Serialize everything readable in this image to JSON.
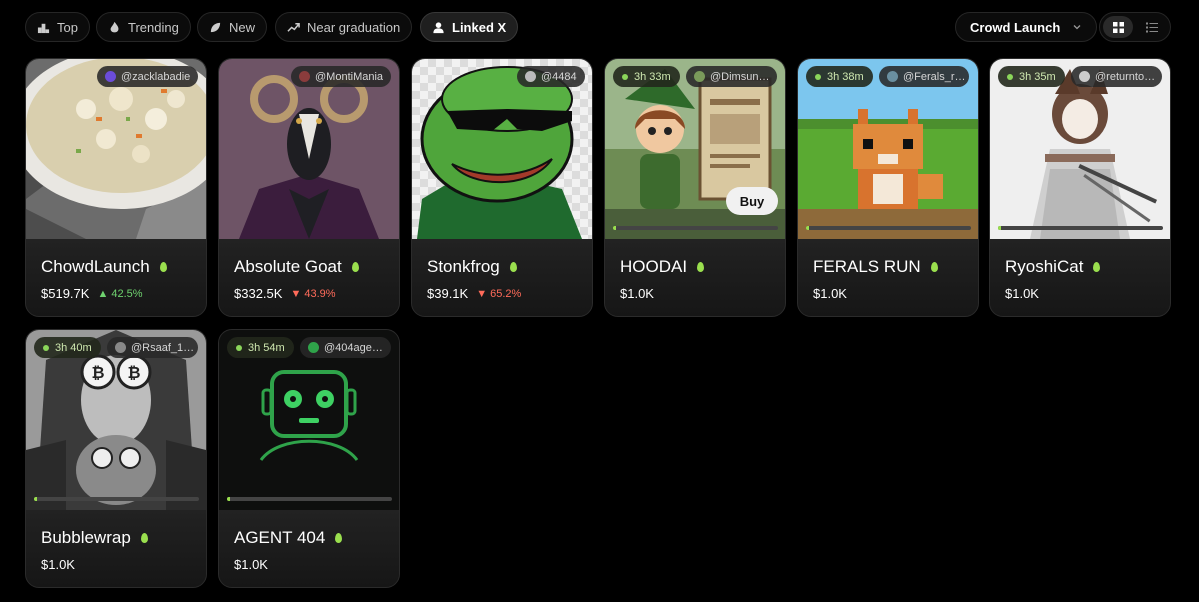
{
  "tabs": [
    {
      "label": "Top",
      "icon": "podium-icon"
    },
    {
      "label": "Trending",
      "icon": "flame-icon"
    },
    {
      "label": "New",
      "icon": "leaf-icon"
    },
    {
      "label": "Near graduation",
      "icon": "trend-up-icon"
    },
    {
      "label": "Linked X",
      "icon": "user-icon",
      "active": true
    }
  ],
  "launch_filter": {
    "label": "Crowd Launch"
  },
  "view": {
    "active": "grid"
  },
  "colors": {
    "accent": "#9adf4e",
    "up": "#6fd26f",
    "down": "#ff6b5a"
  },
  "cards": [
    {
      "name": "ChowdLaunch",
      "handle": "@zacklabadie",
      "price": "$519.7K",
      "change": "42.5%",
      "direction": "up"
    },
    {
      "name": "Absolute Goat",
      "handle": "@MontiMania",
      "price": "$332.5K",
      "change": "43.9%",
      "direction": "down"
    },
    {
      "name": "Stonkfrog",
      "handle": "@4484",
      "price": "$39.1K",
      "change": "65.2%",
      "direction": "down"
    },
    {
      "name": "HOODAI",
      "handle": "@Dimsun…",
      "time": "3h 33m",
      "price": "$1.0K",
      "buy_label": "Buy",
      "progress": 0.02
    },
    {
      "name": "FERALS RUN",
      "handle": "@Ferals_r…",
      "time": "3h 38m",
      "price": "$1.0K",
      "progress": 0.02
    },
    {
      "name": "RyoshiCat",
      "handle": "@returnto…",
      "time": "3h 35m",
      "price": "$1.0K",
      "progress": 0.02
    },
    {
      "name": "Bubblewrap",
      "handle": "@Rsaaf_1…",
      "time": "3h 40m",
      "price": "$1.0K",
      "progress": 0.02
    },
    {
      "name": "AGENT 404",
      "handle": "@404age…",
      "time": "3h 54m",
      "price": "$1.0K",
      "progress": 0.02
    }
  ]
}
